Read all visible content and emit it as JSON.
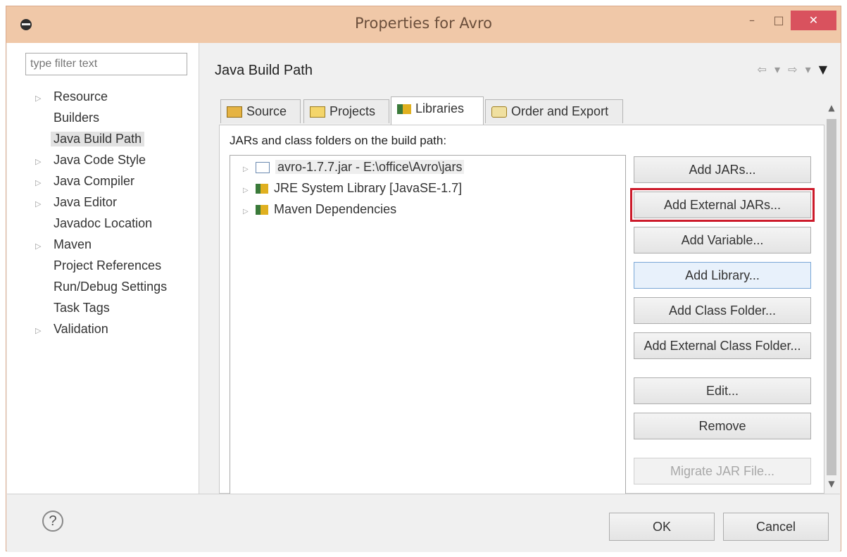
{
  "window": {
    "title": "Properties for Avro",
    "minimize": "–",
    "maximize": "□",
    "close": "✕"
  },
  "sidebar": {
    "filter_placeholder": "type filter text",
    "items": [
      {
        "label": "Resource",
        "expandable": true
      },
      {
        "label": "Builders",
        "expandable": false
      },
      {
        "label": "Java Build Path",
        "expandable": false,
        "selected": true
      },
      {
        "label": "Java Code Style",
        "expandable": true
      },
      {
        "label": "Java Compiler",
        "expandable": true
      },
      {
        "label": "Java Editor",
        "expandable": true
      },
      {
        "label": "Javadoc Location",
        "expandable": false
      },
      {
        "label": "Maven",
        "expandable": true
      },
      {
        "label": "Project References",
        "expandable": false
      },
      {
        "label": "Run/Debug Settings",
        "expandable": false
      },
      {
        "label": "Task Tags",
        "expandable": false
      },
      {
        "label": "Validation",
        "expandable": true
      }
    ]
  },
  "main": {
    "heading": "Java Build Path",
    "nav": {
      "back": "⇦",
      "back_menu": "▾",
      "forward": "⇨",
      "forward_menu": "▾",
      "menu": "▼"
    },
    "tabs": [
      {
        "label": "Source",
        "icon": "source-folder-icon"
      },
      {
        "label": "Projects",
        "icon": "projects-folder-icon"
      },
      {
        "label": "Libraries",
        "icon": "libraries-icon",
        "active": true
      },
      {
        "label": "Order and Export",
        "icon": "order-export-icon"
      }
    ],
    "libraries_panel": {
      "description": "JARs and class folders on the build path:",
      "entries": [
        {
          "label": "avro-1.7.7.jar - E:\\office\\Avro\\jars",
          "icon": "jar-icon"
        },
        {
          "label": "JRE System Library [JavaSE-1.7]",
          "icon": "library-icon"
        },
        {
          "label": "Maven Dependencies",
          "icon": "library-icon"
        }
      ],
      "buttons": [
        {
          "label": "Add JARs...",
          "state": "normal"
        },
        {
          "label": "Add External JARs...",
          "state": "highlighted"
        },
        {
          "label": "Add Variable...",
          "state": "normal"
        },
        {
          "label": "Add Library...",
          "state": "focused"
        },
        {
          "label": "Add Class Folder...",
          "state": "normal"
        },
        {
          "label": "Add External Class Folder...",
          "state": "normal"
        },
        {
          "label": "Edit...",
          "state": "normal"
        },
        {
          "label": "Remove",
          "state": "normal"
        },
        {
          "label": "Migrate JAR File...",
          "state": "disabled"
        }
      ]
    }
  },
  "footer": {
    "help": "?",
    "ok": "OK",
    "cancel": "Cancel"
  },
  "colors": {
    "titlebar": "#f0c8a8",
    "close_button": "#d9525e",
    "highlight_outline": "#cc1a2a",
    "focused_button": "#7aa7d6"
  }
}
